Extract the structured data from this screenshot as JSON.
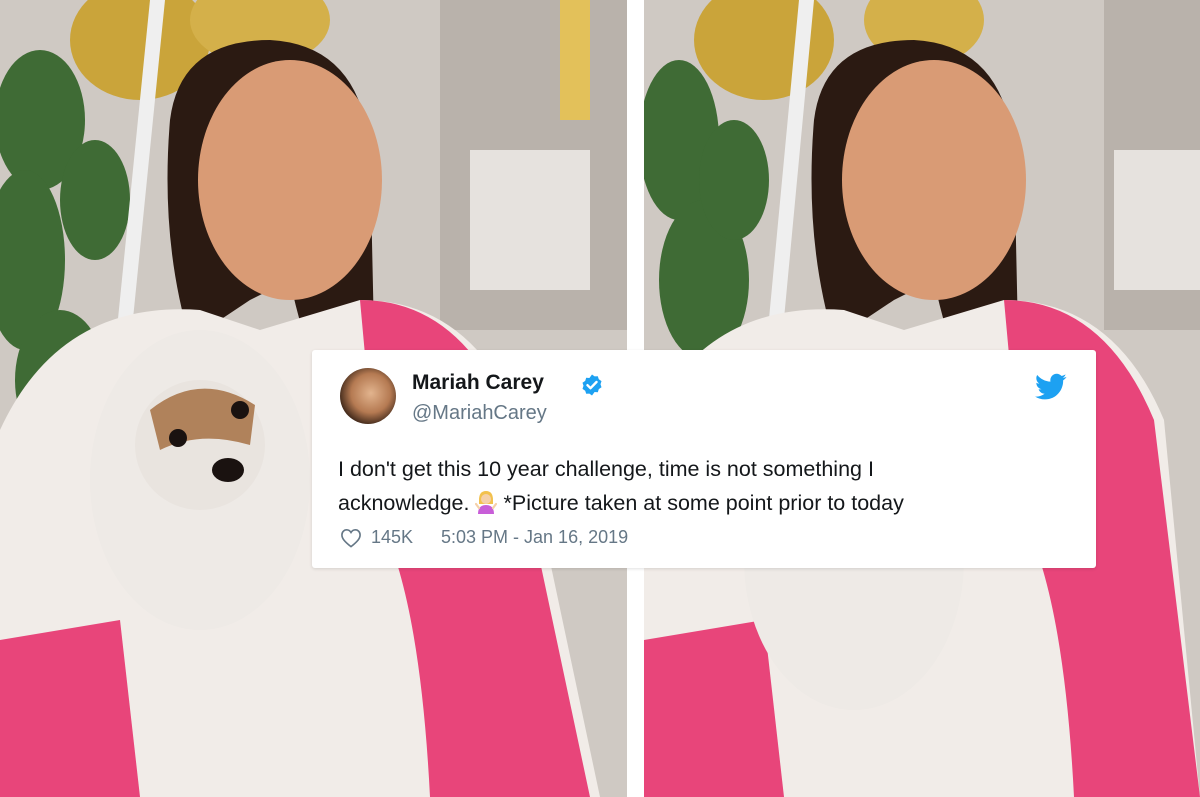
{
  "tweet": {
    "display_name": "Mariah Carey",
    "handle": "@MariahCarey",
    "verified": true,
    "text_line1": "I don't get this 10 year challenge, time is not something I",
    "text_line2_start": "acknowledge.",
    "emoji": "woman-shrugging-emoji",
    "text_line2_end": "*Picture taken at some point prior to today",
    "likes": "145K",
    "timestamp": "5:03 PM - Jan 16, 2019"
  },
  "icons": {
    "verified": "verified-badge-icon",
    "brand": "twitter-bird-icon",
    "like": "heart-icon"
  },
  "colors": {
    "twitter_blue": "#1da1f2",
    "name_text": "#14171a",
    "secondary_text": "#657786",
    "robe_pink": "#e8457a",
    "balloon_gold": "#c9a227"
  }
}
